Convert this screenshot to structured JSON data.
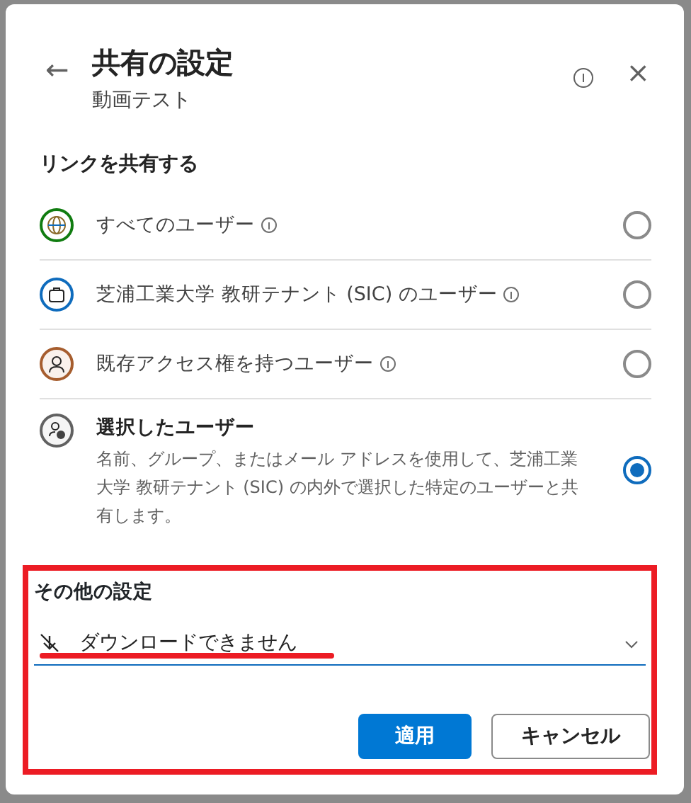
{
  "dialog": {
    "back": "←",
    "title": "共有の設定",
    "subtitle": "動画テスト",
    "close": "×"
  },
  "section_title": "リンクを共有する",
  "options": [
    {
      "label": "すべてのユーザー",
      "info": true,
      "selected": false,
      "color": "#107c10"
    },
    {
      "label": "芝浦工業大学 教研テナント (SIC) のユーザー",
      "info": true,
      "selected": false,
      "color": "#0f6cbd"
    },
    {
      "label": "既存アクセス権を持つユーザー",
      "info": true,
      "selected": false,
      "color": "#a65d2e"
    },
    {
      "label": "選択したユーザー",
      "info": false,
      "description": "名前、グループ、またはメール アドレスを使用して、芝浦工業大学 教研テナント (SIC) の内外で選択した特定のユーザーと共有します。",
      "selected": true,
      "color": "#616161"
    }
  ],
  "other_settings": {
    "title": "その他の設定",
    "value": "ダウンロードできません"
  },
  "buttons": [
    {
      "label": "適用",
      "kind": "primary"
    },
    {
      "label": "キャンセル",
      "kind": "secondary"
    }
  ]
}
